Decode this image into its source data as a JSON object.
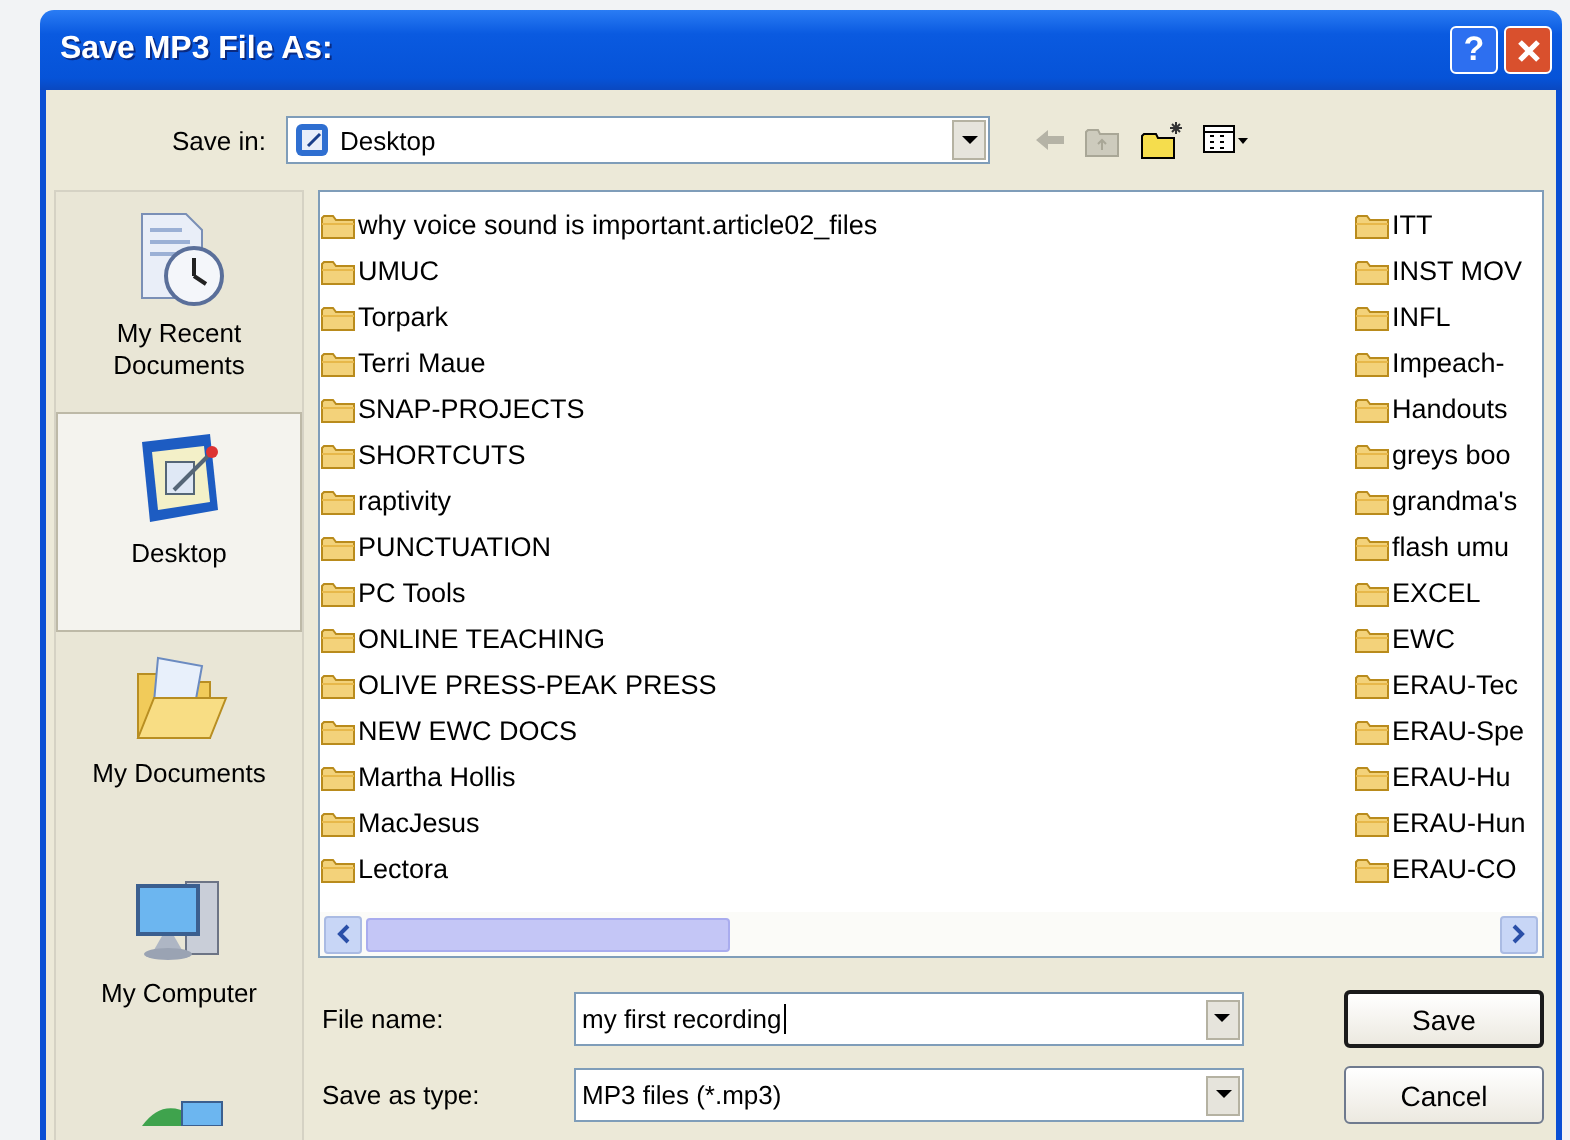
{
  "window": {
    "title": "Save MP3 File As:",
    "help": "?"
  },
  "save_in": {
    "label": "Save in:",
    "value": "Desktop"
  },
  "places": [
    {
      "kind": "recent",
      "label": "My Recent Documents",
      "selected": false
    },
    {
      "kind": "desktop",
      "label": "Desktop",
      "selected": true
    },
    {
      "kind": "documents",
      "label": "My Documents",
      "selected": false
    },
    {
      "kind": "computer",
      "label": "My Computer",
      "selected": false
    },
    {
      "kind": "network",
      "selected": false
    }
  ],
  "file_columns": [
    [
      "why voice sound is important.article02_files",
      "UMUC",
      "Torpark",
      "Terri Maue",
      "SNAP-PROJECTS",
      "SHORTCUTS",
      "raptivity",
      "PUNCTUATION",
      "PC Tools",
      "ONLINE TEACHING",
      "OLIVE PRESS-PEAK PRESS",
      "NEW EWC DOCS",
      "Martha Hollis",
      "MacJesus",
      "Lectora"
    ],
    [
      "ITT",
      "INST MOV",
      "INFL",
      "Impeach-",
      "Handouts",
      "greys boo",
      "grandma's",
      "flash umu",
      "EXCEL",
      "EWC",
      "ERAU-Tec",
      "ERAU-Spe",
      "ERAU-Hu",
      "ERAU-Hun",
      "ERAU-CO"
    ]
  ],
  "file_name": {
    "label": "File name:",
    "value": "my first recording"
  },
  "save_as_type": {
    "label": "Save as type:",
    "value": "MP3 files (*.mp3)"
  },
  "buttons": [
    {
      "label": "Save",
      "default": true
    },
    {
      "label": "Cancel",
      "default": false
    }
  ]
}
